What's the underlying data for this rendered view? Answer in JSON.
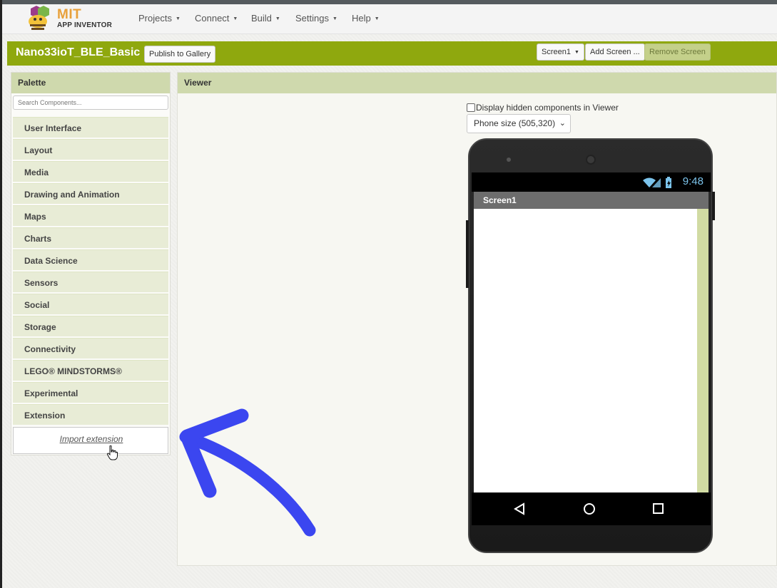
{
  "app": {
    "logo_line1": "MIT",
    "logo_line2": "APP INVENTOR"
  },
  "nav": {
    "items": [
      "Projects",
      "Connect",
      "Build",
      "Settings",
      "Help"
    ]
  },
  "project": {
    "name": "Nano33ioT_BLE_Basic",
    "publish_label": "Publish to Gallery",
    "screen_select": "Screen1",
    "add_screen_label": "Add Screen ...",
    "remove_screen_label": "Remove Screen"
  },
  "palette": {
    "title": "Palette",
    "search_placeholder": "Search Components...",
    "categories": [
      "User Interface",
      "Layout",
      "Media",
      "Drawing and Animation",
      "Maps",
      "Charts",
      "Data Science",
      "Sensors",
      "Social",
      "Storage",
      "Connectivity",
      "LEGO® MINDSTORMS®",
      "Experimental",
      "Extension"
    ],
    "import_label": "Import extension"
  },
  "viewer": {
    "title": "Viewer",
    "hidden_components_label": "Display hidden components in Viewer",
    "size_option": "Phone size (505,320)",
    "phone": {
      "time": "9:48",
      "screen_title": "Screen1"
    }
  },
  "colors": {
    "accent_green": "#8fa80e",
    "panel_header": "#cfd9ad",
    "annotation_arrow": "#3b46f0",
    "status_time": "#7cc4ec"
  },
  "icons": [
    "wifi-icon",
    "signal-icon",
    "battery-icon",
    "back-icon",
    "home-icon",
    "recents-icon",
    "hand-cursor-icon",
    "chevron-down-icon"
  ]
}
